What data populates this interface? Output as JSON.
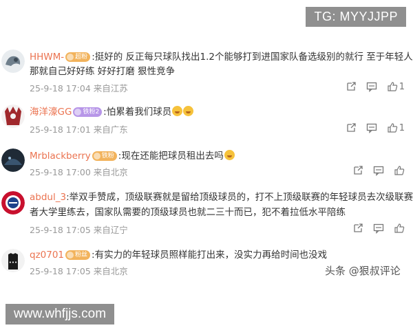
{
  "tg_badge": "TG: MYYJJPP",
  "watermark_right": "头条 @狠叔评论",
  "watermark_bottom": "www.whfjjs.com",
  "comments": [
    {
      "username": "HHWM-",
      "badge": "",
      "text_line1": ":挺好的 反正每只球队找出1.2个能够打到进国家队备选级别的就行 至于年轻人",
      "text_line2": "那就自己好好练 好好打磨 狠性竞争",
      "time": "25-9-18 17:04",
      "location": "来自江苏",
      "likes": "1"
    },
    {
      "username": "海洋濠GG",
      "badge": "",
      "text_line1": ":怕累着我们球员",
      "time": "25-9-18 17:01",
      "location": "来自广东",
      "likes": "1"
    },
    {
      "username": "Mrblackberry",
      "badge": "",
      "text_line1": ":现在还能把球员租出去吗",
      "time": "25-9-18 17:00",
      "location": "来自北京",
      "likes": ""
    },
    {
      "username": "abdul_3",
      "badge": "",
      "text_line1": ":举双手赞成，顶级联赛就是留给顶级球员的，打不上顶级联赛的年轻球员去次级联赛或",
      "text_line2": "者大学里练去，国家队需要的顶级球员也就二三十而已，犯不着拉低水平陪练",
      "time": "25-9-18 17:05",
      "location": "来自辽宁",
      "likes": ""
    },
    {
      "username": "qz0701",
      "badge": "",
      "text_line1": ":有实力的年轻球员照样能打出来，没实力再给时间也没戏",
      "time": "25-9-18 17:05",
      "location": "来自北京",
      "likes": ""
    }
  ]
}
